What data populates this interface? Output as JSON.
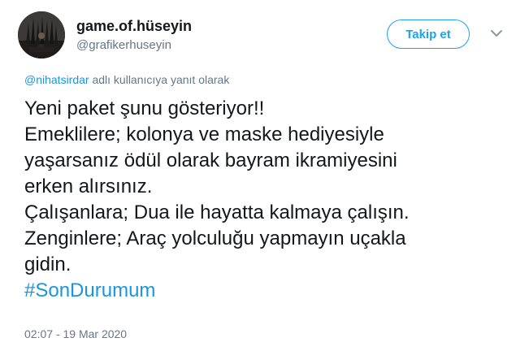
{
  "author": {
    "display_name": "game.of.hüseyin",
    "handle": "@grafikerhuseyin",
    "avatar_icon": "throne-avatar-icon"
  },
  "follow_button": {
    "label": "Takip et"
  },
  "menu_icon": "chevron-down-icon",
  "reply_context": {
    "mention": "@nihatsirdar",
    "suffix": " adlı kullanıcıya yanıt olarak"
  },
  "tweet": {
    "lines": [
      "Yeni paket şunu gösteriyor!!",
      "Emeklilere; kolonya ve maske hediyesiyle",
      "yaşarsanız ödül olarak bayram ikramiyesini",
      "erken alırsınız.",
      "Çalışanlara; Dua ile hayatta kalmaya çalışın.",
      "Zenginlere; Araç yolculuğu yapmayın uçakla",
      "gidin."
    ],
    "hashtag": "#SonDurumum"
  },
  "timestamp": "02:07 - 19 Mar 2020",
  "colors": {
    "accent": "#1da1f2",
    "link": "#1b95e0",
    "text": "#14171a",
    "muted": "#657786"
  }
}
